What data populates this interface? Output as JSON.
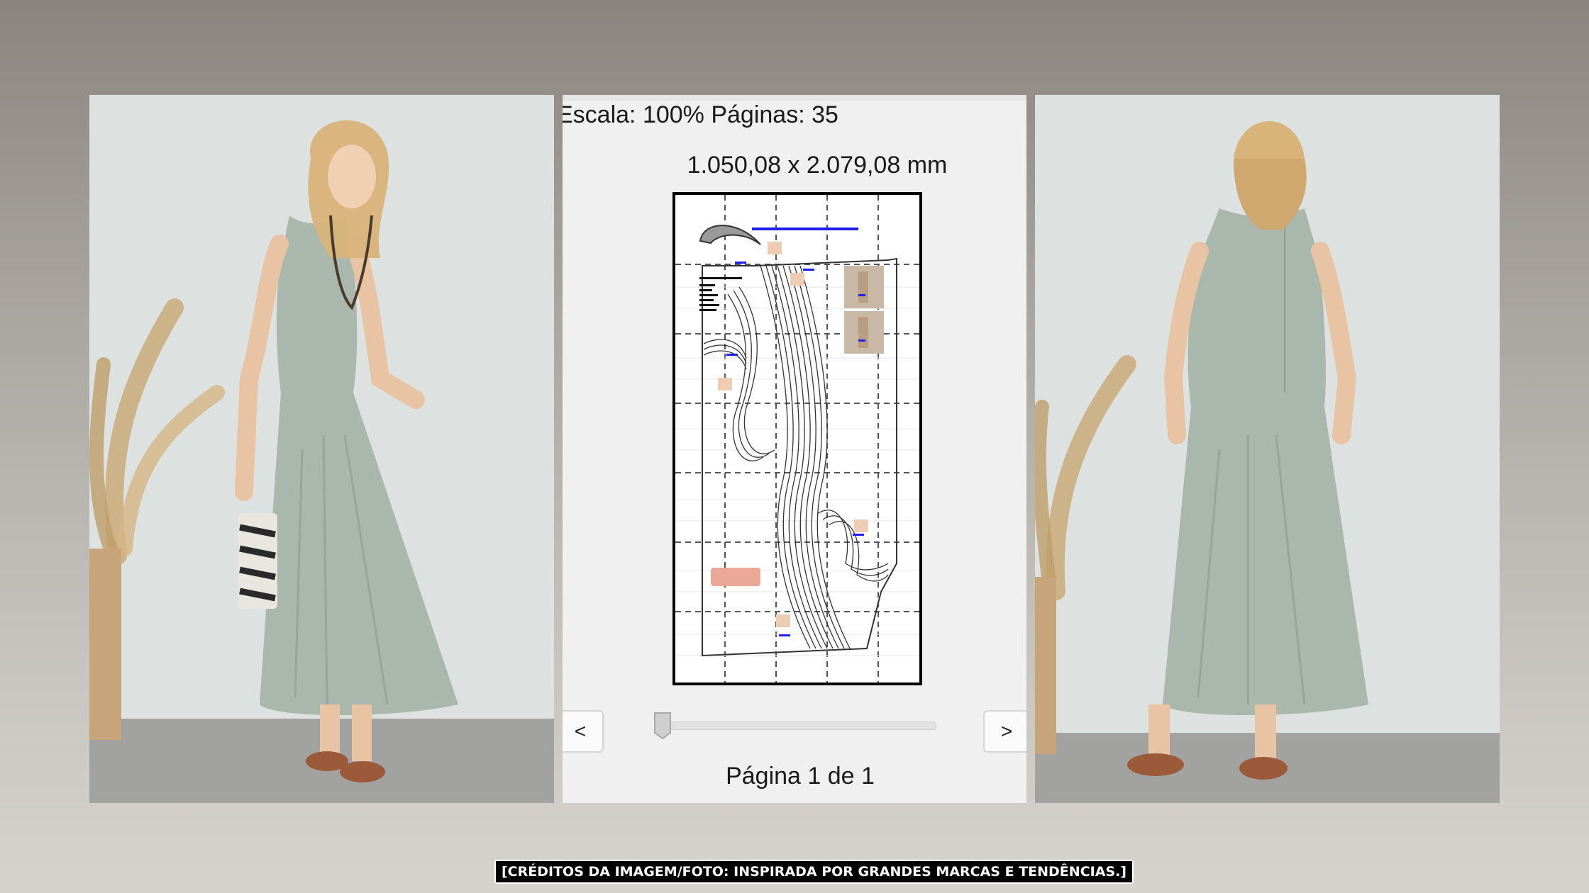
{
  "viewer": {
    "scale_label": "Escala: 100% Páginas: 35",
    "dimensions_label": "1.050,08 x 2.079,08 mm",
    "prev_label": "<",
    "next_label": ">",
    "page_label": "Página 1 de 1",
    "slider_position_fraction": 0.0
  },
  "credits": "[CRÉDITOS DA IMAGEM/FOTO: INSPIRADA POR GRANDES MARCAS E TENDÊNCIAS.]",
  "colors": {
    "dress": "#a9b7ad",
    "wall": "#d9dedd",
    "floor": "#9a9b98",
    "frame_background": "#8a847f",
    "viewer_background": "#f0f0f0",
    "pattern_label_blue": "#2020ee"
  },
  "photos": [
    {
      "name": "model-front",
      "view": "front"
    },
    {
      "name": "model-back",
      "view": "back"
    }
  ]
}
